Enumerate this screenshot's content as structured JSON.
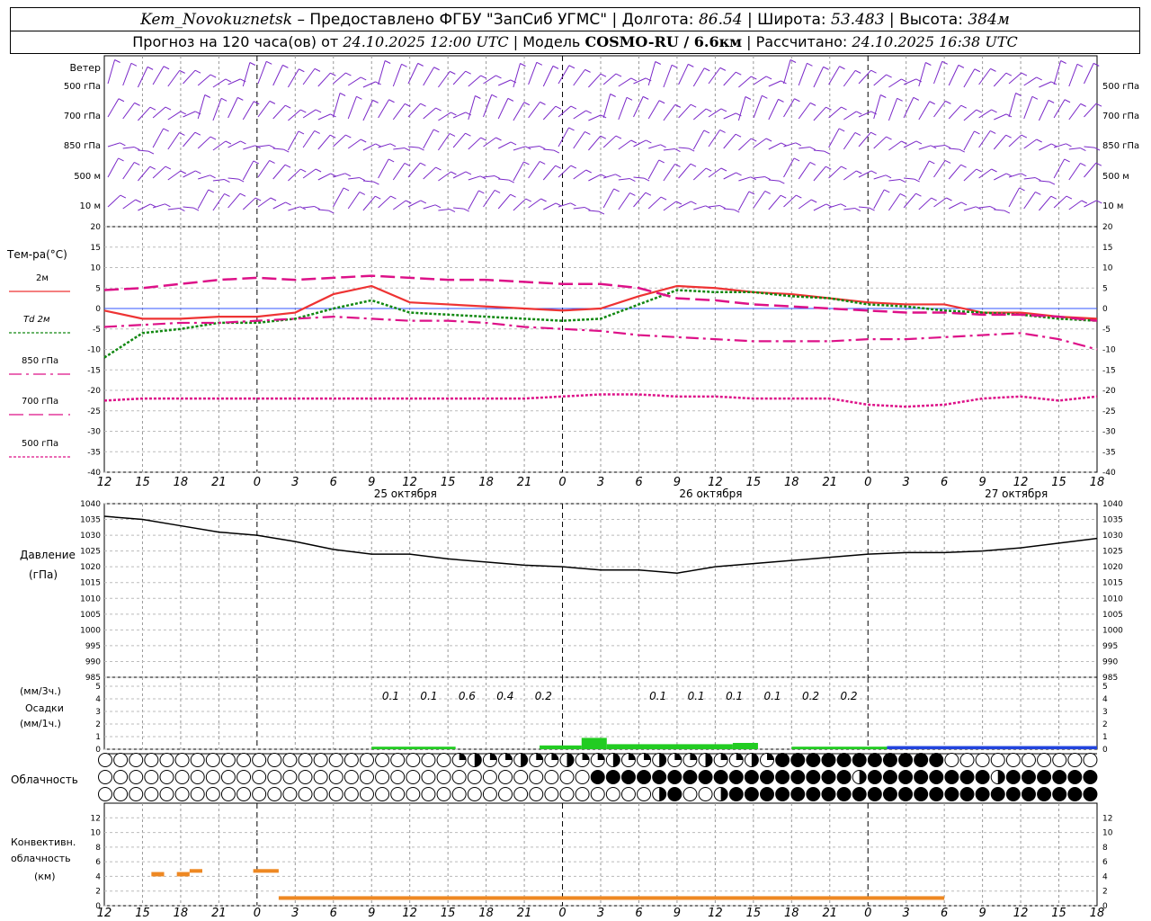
{
  "header": {
    "station": "Kem_Novokuznetsk",
    "dash": "–",
    "provider": "Предоставлено ФГБУ \"ЗапСиб УГМС\"",
    "lon_label": "Долгота:",
    "lon": "86.54",
    "lat_label": "Широта:",
    "lat": "53.483",
    "alt_label": "Высота:",
    "alt": "384м",
    "forecast_prefix": "Прогноз на 120 часа(ов) от",
    "forecast_time": "24.10.2025 12:00 UTC",
    "model_label": "Модель",
    "model": "COSMO-RU / 6.6км",
    "calc_label": "Рассчитано:",
    "calc_time": "24.10.2025 16:38 UTC"
  },
  "labels": {
    "wind": "Ветер",
    "wind_levels": [
      "500 гПа",
      "700 гПа",
      "850 гПа",
      "500 м",
      "10 м"
    ],
    "temp": "Тем-ра(°C)",
    "legend": [
      "2м",
      "Td 2м",
      "850 гПа",
      "700 гПа",
      "500 гПа"
    ],
    "pressure": [
      "Давление",
      "(гПа)"
    ],
    "precip": [
      "(мм/3ч.)",
      "Осадки",
      "(мм/1ч.)"
    ],
    "cloud": "Облачность",
    "conv": [
      "Конвективн.",
      "облачность",
      "(км)"
    ],
    "dates": [
      "25 октября",
      "26 октября",
      "27 октября"
    ]
  },
  "colors": {
    "wind": "#7a28c8",
    "t2m": "#ee3333",
    "td2m": "#118811",
    "t850": "#dd1188",
    "pressure": "#000000",
    "precip_green": "#22cc22",
    "precip_blue": "#2244dd",
    "conv": "#ee8822"
  },
  "chart_data": [
    {
      "type": "line",
      "name": "temperature",
      "x_hours": [
        12,
        15,
        18,
        21,
        0,
        3,
        6,
        9,
        12,
        15,
        18,
        21,
        0,
        3,
        6,
        9,
        12,
        15,
        18,
        21,
        0,
        3,
        6,
        9,
        12,
        15,
        18
      ],
      "ylim": [
        -40,
        20
      ],
      "yticks": [
        20,
        15,
        10,
        5,
        0,
        -5,
        -10,
        -15,
        -20,
        -25,
        -30,
        -35,
        -40
      ],
      "series": [
        {
          "name": "2м",
          "values": [
            -0.5,
            -2.5,
            -2.5,
            -2,
            -2,
            -1,
            3.5,
            5.5,
            1.5,
            1,
            0.5,
            0,
            -0.5,
            0,
            3,
            5.5,
            5,
            4,
            3.5,
            2.5,
            1.5,
            1,
            1,
            -1,
            -1,
            -2,
            -2.5
          ]
        },
        {
          "name": "Td 2м",
          "values": [
            -12,
            -6,
            -5,
            -3.5,
            -3.5,
            -2.5,
            0,
            2,
            -1,
            -1.5,
            -2,
            -2.5,
            -3,
            -2.5,
            1,
            4.5,
            4,
            4,
            3,
            2.5,
            1,
            0.5,
            -0.5,
            -1,
            -1.5,
            -2.5,
            -3
          ]
        },
        {
          "name": "850 гПа",
          "values": [
            -4.5,
            -4,
            -3.5,
            -3.5,
            -3,
            -2.5,
            -2,
            -2.5,
            -3,
            -3,
            -3.5,
            -4.5,
            -5,
            -5.5,
            -6.5,
            -7,
            -7.5,
            -8,
            -8,
            -8,
            -7.5,
            -7.5,
            -7,
            -6.5,
            -6,
            -7.5,
            -10
          ]
        },
        {
          "name": "700 гПа",
          "values": [
            4.5,
            5,
            6,
            7,
            7.5,
            7,
            7.5,
            8,
            7.5,
            7,
            7,
            6.5,
            6,
            6,
            5,
            2.5,
            2,
            1,
            0.5,
            0,
            -0.5,
            -1,
            -1,
            -1.5,
            -1.5,
            -2,
            -3
          ]
        },
        {
          "name": "500 гПа",
          "values": [
            -22.5,
            -22,
            -22,
            -22,
            -22,
            -22,
            -22,
            -22,
            -22,
            -22,
            -22,
            -22,
            -21.5,
            -21,
            -21,
            -21.5,
            -21.5,
            -22,
            -22,
            -22,
            -23.5,
            -24,
            -23.5,
            -22,
            -21.5,
            -22.5,
            -21.5
          ]
        }
      ]
    },
    {
      "type": "line",
      "name": "pressure",
      "ylim": [
        985,
        1040
      ],
      "yticks": [
        1040,
        1035,
        1030,
        1025,
        1020,
        1015,
        1010,
        1005,
        1000,
        995,
        990,
        985
      ],
      "values": [
        1036,
        1035,
        1033,
        1031,
        1030,
        1028,
        1025.5,
        1024,
        1024,
        1022.5,
        1021.5,
        1020.5,
        1020,
        1019,
        1019,
        1018,
        1020,
        1021,
        1022,
        1023,
        1024,
        1024.5,
        1024.5,
        1025,
        1026,
        1027.5,
        1029
      ]
    },
    {
      "type": "bar",
      "name": "precipitation",
      "ylim": [
        0,
        5
      ],
      "totals_3h": [
        {
          "hour": "9",
          "value": "0.1"
        },
        {
          "hour": "12",
          "value": "0.1"
        },
        {
          "hour": "15",
          "value": "0.6"
        },
        {
          "hour": "18",
          "value": "0.4"
        },
        {
          "hour": "21",
          "value": "0.2"
        },
        {
          "hour": "3",
          "value": "0.1"
        },
        {
          "hour": "6",
          "value": "0.1"
        },
        {
          "hour": "9",
          "value": "0.1"
        },
        {
          "hour": "12",
          "value": "0.1"
        },
        {
          "hour": "15",
          "value": "0.2"
        },
        {
          "hour": "18",
          "value": "0.2"
        }
      ]
    },
    {
      "type": "bar",
      "name": "convective_cloud",
      "ylim": [
        0,
        14
      ],
      "yticks": [
        12,
        10,
        8,
        6,
        4,
        2,
        0
      ],
      "segments": [
        {
          "from": 3.7,
          "to": 4.7,
          "base": 4,
          "top": 4.6
        },
        {
          "from": 5.7,
          "to": 6.7,
          "base": 4,
          "top": 4.6
        },
        {
          "from": 6.7,
          "to": 7.7,
          "base": 4.5,
          "top": 5
        },
        {
          "from": 11.7,
          "to": 13.7,
          "base": 4.5,
          "top": 5
        },
        {
          "from": 13.7,
          "to": 66,
          "base": 0.8,
          "top": 1.3
        }
      ]
    }
  ]
}
